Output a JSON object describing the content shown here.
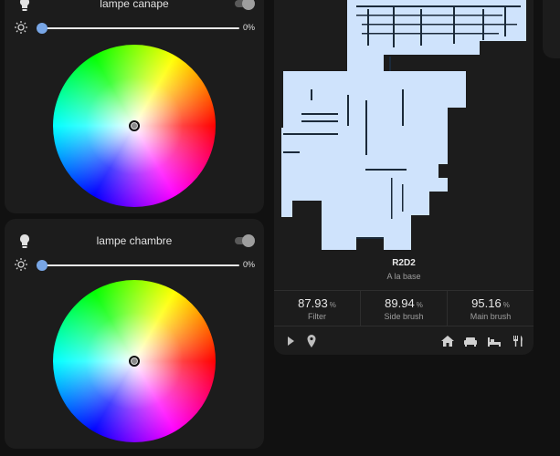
{
  "lights": [
    {
      "name": "lampe canape",
      "brightness_text": "0%",
      "brightness": 0
    },
    {
      "name": "lampe chambre",
      "brightness_text": "0%",
      "brightness": 0
    }
  ],
  "vacuum": {
    "name": "R2D2",
    "status": "A la base",
    "stats": [
      {
        "value": "87.93",
        "unit": "%",
        "label": "Filter"
      },
      {
        "value": "89.94",
        "unit": "%",
        "label": "Side brush"
      },
      {
        "value": "95.16",
        "unit": "%",
        "label": "Main brush"
      }
    ],
    "icons": [
      "play-icon",
      "locate-icon",
      "home-icon",
      "sofa-icon",
      "bed-icon",
      "dining-icon"
    ]
  },
  "colors": {
    "card": "#1c1c1c",
    "background": "#111111",
    "accent": "#78a6e6",
    "map_fill": "#cfe3fc",
    "map_wall": "#1b2a3a"
  }
}
